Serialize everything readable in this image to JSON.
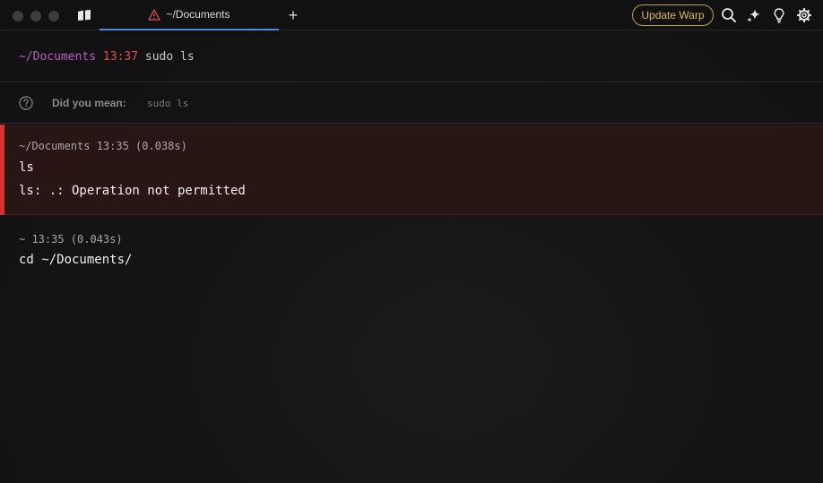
{
  "titlebar": {
    "tab_title": "~/Documents",
    "new_tab_label": "+",
    "update_label": "Update Warp",
    "icons": [
      "drawer-icon",
      "warning-icon",
      "search-icon",
      "ai-sparkle-icon",
      "lightbulb-icon",
      "gear-icon"
    ]
  },
  "input": {
    "dir": "~/Documents",
    "time": "13:37",
    "command": "sudo ls"
  },
  "suggestion": {
    "label": "Did you mean:",
    "command": "sudo ls"
  },
  "blocks": [
    {
      "meta": "~/Documents 13:35 (0.038s)",
      "command": "ls",
      "output": "ls: .: Operation not permitted",
      "status": "error"
    },
    {
      "meta": "~ 13:35 (0.043s)",
      "command": "cd ~/Documents/",
      "status": "ok"
    }
  ],
  "colors": {
    "accent_tab": "#4f86d9",
    "update": "#e3b652",
    "prompt_dir": "#c05ac8",
    "prompt_time": "#e05050",
    "error_bar": "#d63030",
    "error_bg": "#2a1515"
  }
}
